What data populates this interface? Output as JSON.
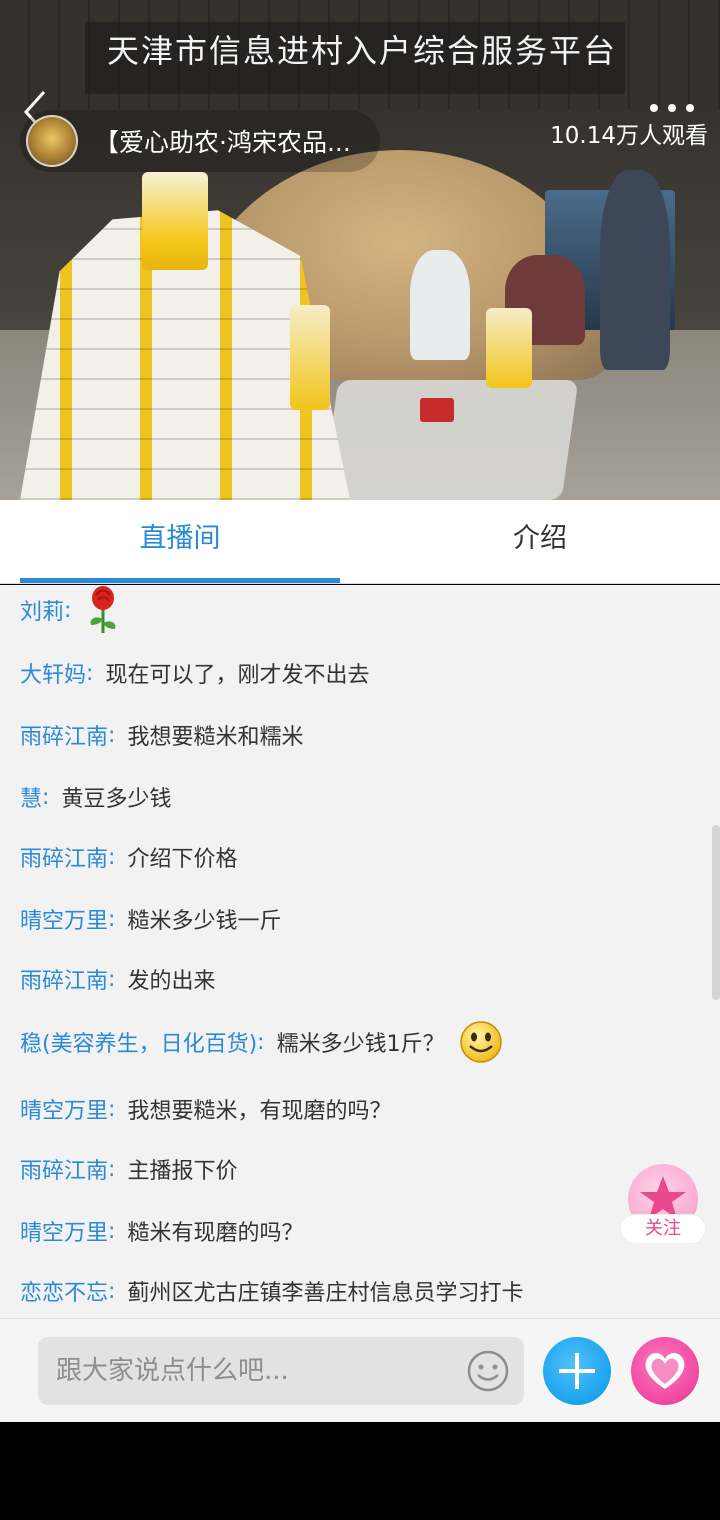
{
  "header": {
    "platform_title": "天津市信息进村入户综合服务平台",
    "room_title": "【爱心助农·鸿宋农品...",
    "viewer_count": "10.14万人观看"
  },
  "tabs": [
    {
      "label": "直播间",
      "active": true
    },
    {
      "label": "介绍",
      "active": false
    }
  ],
  "chat": {
    "messages": [
      {
        "name": "刘莉",
        "text": "",
        "emoji": "rose-icon"
      },
      {
        "name": "大轩妈",
        "text": "现在可以了，刚才发不出去"
      },
      {
        "name": "雨碎江南",
        "text": "我想要糙米和糯米"
      },
      {
        "name": "慧",
        "text": "黄豆多少钱"
      },
      {
        "name": "雨碎江南",
        "text": "介绍下价格"
      },
      {
        "name": "晴空万里",
        "text": "糙米多少钱一斤"
      },
      {
        "name": "雨碎江南",
        "text": "发的出来"
      },
      {
        "name": "稳(美容养生，日化百货)",
        "text": "糯米多少钱1斤？",
        "emoji": "smiley-icon"
      },
      {
        "name": "晴空万里",
        "text": "我想要糙米，有现磨的吗？"
      },
      {
        "name": "雨碎江南",
        "text": "主播报下价"
      },
      {
        "name": "晴空万里",
        "text": "糙米有现磨的吗？"
      },
      {
        "name": "恋恋不忘",
        "text": "蓟州区尤古庄镇李善庄村信息员学习打卡"
      }
    ]
  },
  "follow": {
    "label": "关注"
  },
  "input": {
    "placeholder": "跟大家说点什么吧..."
  },
  "colors": {
    "accent": "#2b8ad8",
    "follow_pink": "#e8488e",
    "add_blue": "#1aa3ef",
    "heart_pink": "#f0469f"
  }
}
